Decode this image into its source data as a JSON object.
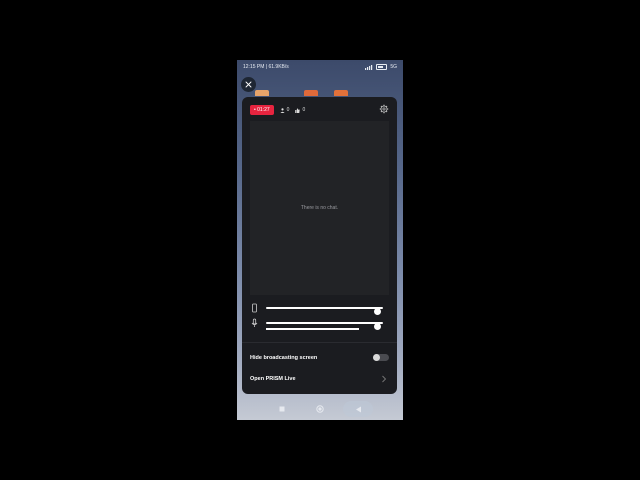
{
  "status_bar": {
    "time": "12:15 PM | 61.9KB/s",
    "right": "5G"
  },
  "stream": {
    "live_timer": "• 01:27",
    "viewers": "0",
    "likes": "0",
    "chat_empty_text": "There is no chat.",
    "device_volume_level": 0.95,
    "mic_volume_level": 0.95
  },
  "settings": {
    "hide_broadcasting_label": "Hide broadcasting screen",
    "hide_broadcasting_on": false,
    "open_prism_label": "Open PRISM Live"
  },
  "colors": {
    "live_badge": "#e7243f",
    "panel_bg": "#1b1c20",
    "chat_bg": "#222326"
  }
}
